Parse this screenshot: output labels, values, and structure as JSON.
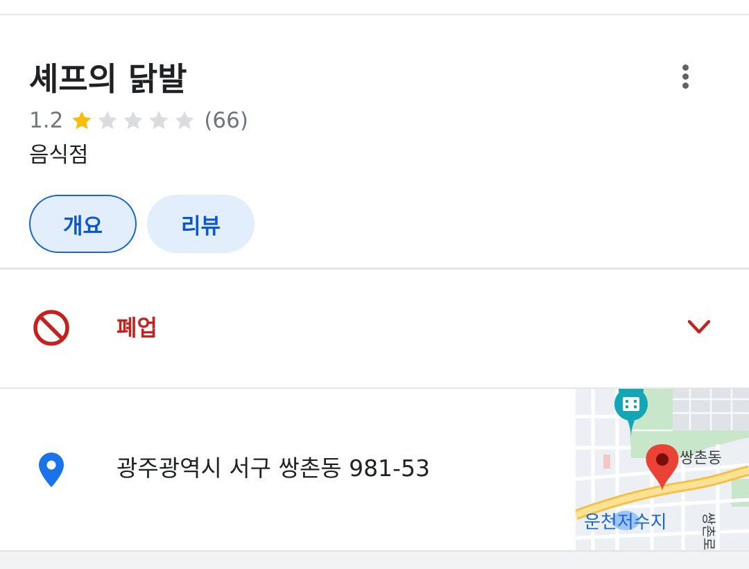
{
  "place": {
    "name": "셰프의 닭발",
    "rating": "1.2",
    "rating_value": 1.2,
    "rating_max": 5,
    "review_count": "(66)",
    "category": "음식점"
  },
  "tabs": [
    {
      "label": "개요",
      "selected": true
    },
    {
      "label": "리뷰",
      "selected": false
    }
  ],
  "status": {
    "label": "폐업",
    "icon": "block-icon",
    "color": "#c5221f"
  },
  "address": {
    "text": "광주광역시 서구 쌍촌동 981-53",
    "icon": "location-pin-icon",
    "map_labels": {
      "district": "쌍촌동",
      "lake": "운천저수지",
      "road": "쌍촌로"
    }
  },
  "colors": {
    "accent": "#0b57d0",
    "star": "#fbbc04",
    "closed": "#c5221f",
    "pin": "#1a73e8"
  }
}
